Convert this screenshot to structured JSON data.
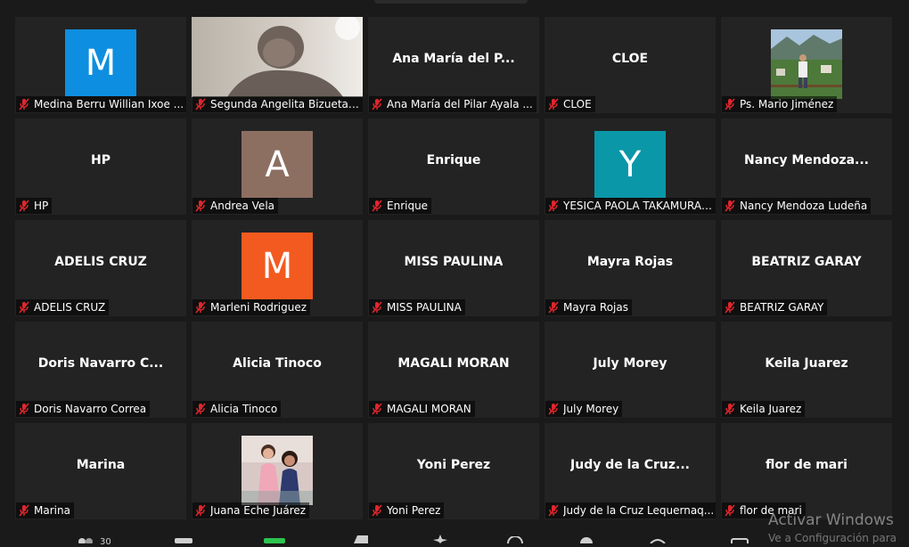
{
  "tiles": [
    {
      "kind": "avatar",
      "letter": "M",
      "color": "#0e8ee0",
      "label": "Medina Berru Willian Ixoe ..."
    },
    {
      "kind": "video",
      "label": "Segunda Angelita Bizueta L..."
    },
    {
      "kind": "name",
      "display": "Ana María del P...",
      "label": "Ana María del Pilar Ayala ..."
    },
    {
      "kind": "name",
      "display": "CLOE",
      "label": "CLOE"
    },
    {
      "kind": "photo",
      "photo": "landscape",
      "label": "Ps. Mario Jiménez"
    },
    {
      "kind": "name",
      "display": "HP",
      "label": "HP"
    },
    {
      "kind": "avatar",
      "letter": "A",
      "color": "#8d6f62",
      "label": "Andrea Vela"
    },
    {
      "kind": "name",
      "display": "Enrique",
      "label": "Enrique"
    },
    {
      "kind": "avatar",
      "letter": "Y",
      "color": "#0a97a8",
      "label": "YESICA PAOLA TAKAMURA ..."
    },
    {
      "kind": "name",
      "display": "Nancy  Mendoza...",
      "label": "Nancy Mendoza Ludeña"
    },
    {
      "kind": "name",
      "display": "ADELIS CRUZ",
      "label": "ADELIS CRUZ"
    },
    {
      "kind": "avatar",
      "letter": "M",
      "color": "#f25a1f",
      "label": "Marleni Rodriguez"
    },
    {
      "kind": "name",
      "display": "MISS PAULINA",
      "label": "MISS PAULINA"
    },
    {
      "kind": "name",
      "display": "Mayra Rojas",
      "label": "Mayra Rojas"
    },
    {
      "kind": "name",
      "display": "BEATRIZ GARAY",
      "label": "BEATRIZ GARAY"
    },
    {
      "kind": "name",
      "display": "Doris  Navarro  C...",
      "label": "Doris Navarro Correa"
    },
    {
      "kind": "name",
      "display": "Alicia Tinoco",
      "label": "Alicia Tinoco"
    },
    {
      "kind": "name",
      "display": "MAGALI MORAN",
      "label": "MAGALI MORAN"
    },
    {
      "kind": "name",
      "display": "July Morey",
      "label": "July Morey"
    },
    {
      "kind": "name",
      "display": "Keila Juarez",
      "label": "Keila Juarez"
    },
    {
      "kind": "name",
      "display": "Marina",
      "label": "Marina"
    },
    {
      "kind": "photo",
      "photo": "people",
      "label": "Juana Eche Juárez"
    },
    {
      "kind": "name",
      "display": "Yoni Perez",
      "label": "Yoni Perez"
    },
    {
      "kind": "name",
      "display": "Judy de la Cruz...",
      "label": "Judy de la Cruz Lequernaq..."
    },
    {
      "kind": "name",
      "display": "flor de mari",
      "label": "flor de mari"
    }
  ],
  "participants_count": "30",
  "watermark": {
    "title": "Activar Windows",
    "subtitle": "Ve a Configuración para"
  },
  "colors": {
    "muted_mic": "#e0262d",
    "share_green": "#2dc44e"
  }
}
